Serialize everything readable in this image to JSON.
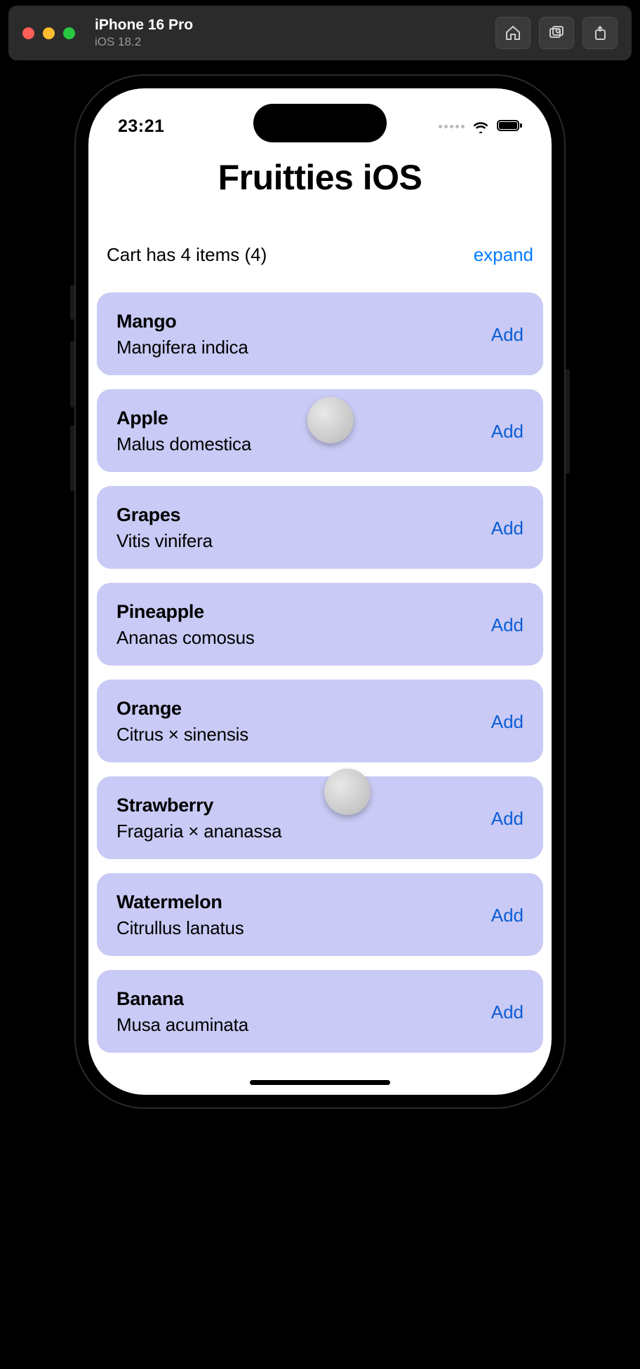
{
  "window": {
    "device": "iPhone 16 Pro",
    "os": "iOS 18.2"
  },
  "status": {
    "time": "23:21"
  },
  "app": {
    "title": "Fruitties iOS",
    "cart_text": "Cart has 4 items (4)",
    "expand_label": "expand",
    "add_label": "Add"
  },
  "fruits": [
    {
      "name": "Mango",
      "sci": "Mangifera indica"
    },
    {
      "name": "Apple",
      "sci": "Malus domestica"
    },
    {
      "name": "Grapes",
      "sci": "Vitis vinifera"
    },
    {
      "name": "Pineapple",
      "sci": "Ananas comosus"
    },
    {
      "name": "Orange",
      "sci": "Citrus × sinensis"
    },
    {
      "name": "Strawberry",
      "sci": "Fragaria × ananassa"
    },
    {
      "name": "Watermelon",
      "sci": "Citrullus lanatus"
    },
    {
      "name": "Banana",
      "sci": "Musa acuminata"
    }
  ]
}
